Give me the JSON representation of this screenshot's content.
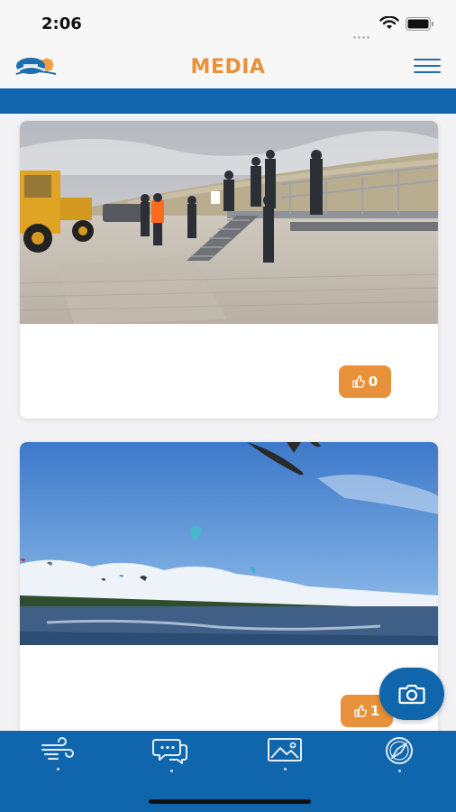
{
  "status_bar": {
    "time": "2:06"
  },
  "header": {
    "title": "MEDIA"
  },
  "posts": [
    {
      "photo": "beach-construction-photo",
      "likes": "0"
    },
    {
      "photo": "kitesurfing-photo",
      "likes": "1"
    }
  ],
  "tabs": [
    {
      "name": "wind",
      "icon": "wind-icon"
    },
    {
      "name": "chat",
      "icon": "chat-icon"
    },
    {
      "name": "media",
      "icon": "image-icon"
    },
    {
      "name": "compass",
      "icon": "compass-icon"
    }
  ],
  "colors": {
    "accent": "#e8913a",
    "brand_blue": "#0f66ad"
  }
}
